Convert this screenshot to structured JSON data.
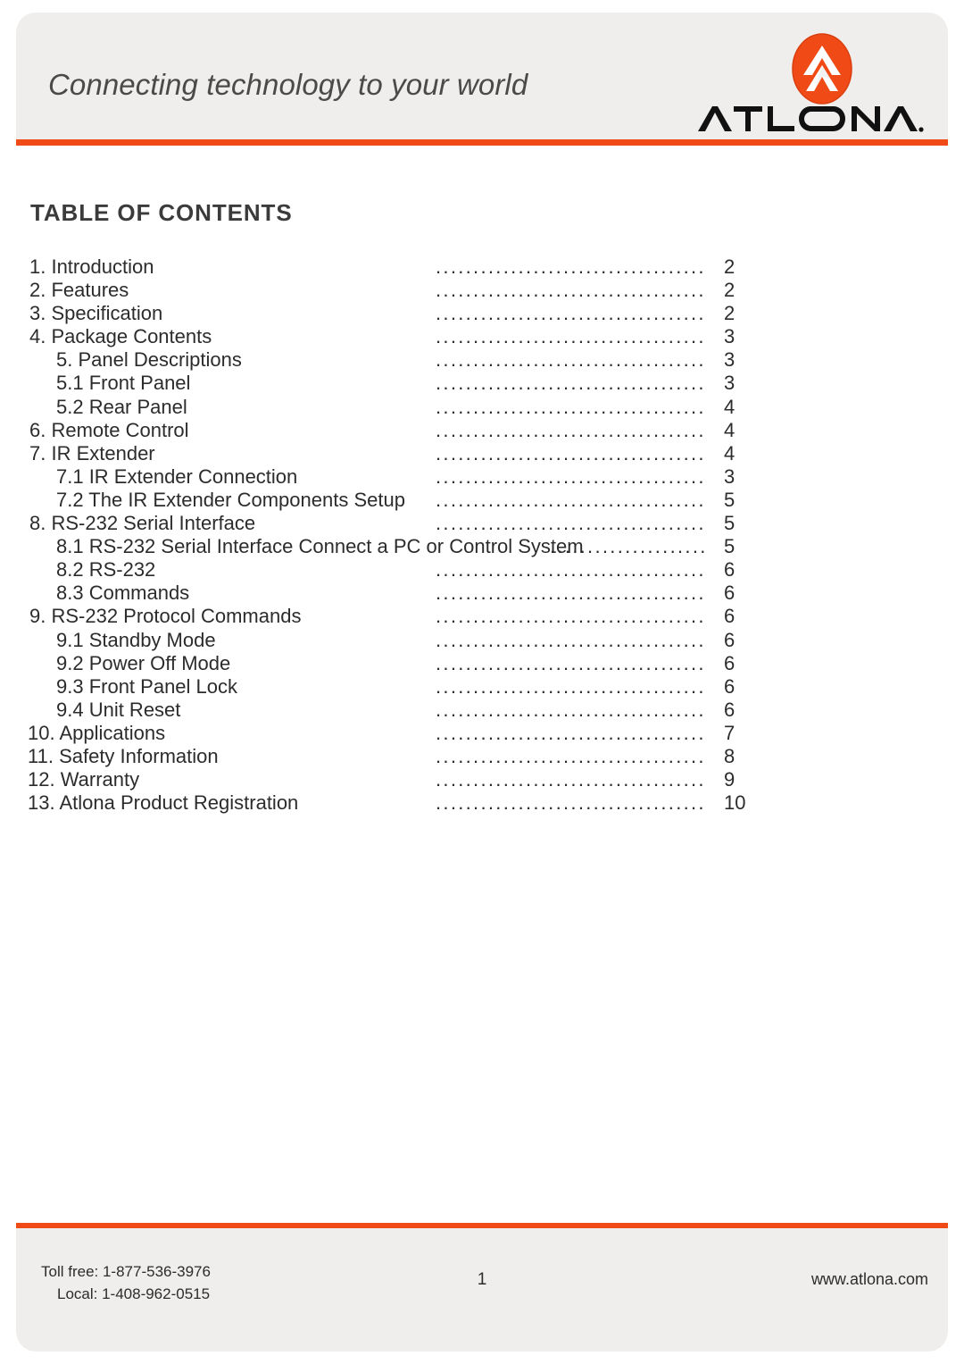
{
  "header": {
    "tagline": "Connecting technology to your world",
    "logo_mark": "atlona-logo-mark",
    "wordmark": "ATLONA."
  },
  "colors": {
    "accent_orange": "#F04A16",
    "band_gray": "#EFEEEC",
    "text": "#2C2C2C",
    "heading": "#3B3B3B"
  },
  "main": {
    "title": "TABLE OF CONTENTS",
    "dot_leader": "...............................................",
    "dot_leader_short": "........................",
    "entries": [
      {
        "label": "1. Introduction",
        "page": "2",
        "level": 0
      },
      {
        "label": "2. Features",
        "page": "2",
        "level": 0
      },
      {
        "label": "3. Specification",
        "page": "2",
        "level": 0
      },
      {
        "label": "4. Package Contents",
        "page": "3",
        "level": 0
      },
      {
        "label": "5. Panel Descriptions",
        "page": "3",
        "level": 1
      },
      {
        "label": "5.1 Front Panel",
        "page": "3",
        "level": 1
      },
      {
        "label": "5.2 Rear Panel",
        "page": "4",
        "level": 1
      },
      {
        "label": "6. Remote Control",
        "page": "4",
        "level": 0
      },
      {
        "label": "7. IR Extender",
        "page": "4",
        "level": 0
      },
      {
        "label": "7.1 IR Extender Connection",
        "page": "3",
        "level": 1
      },
      {
        "label": "7.2 The IR Extender Components Setup",
        "page": "5",
        "level": 1
      },
      {
        "label": "8. RS-232 Serial Interface",
        "page": "5",
        "level": 0
      },
      {
        "label": "8.1 RS-232 Serial Interface Connect a PC or Control System",
        "page": "5",
        "level": 1,
        "long": true
      },
      {
        "label": "8.2 RS-232",
        "page": "6",
        "level": 1
      },
      {
        "label": "8.3 Commands",
        "page": "6",
        "level": 1
      },
      {
        "label": "9. RS-232 Protocol Commands",
        "page": "6",
        "level": 0
      },
      {
        "label": "9.1 Standby Mode",
        "page": "6",
        "level": 1
      },
      {
        "label": "9.2 Power Off Mode",
        "page": "6",
        "level": 1
      },
      {
        "label": "9.3 Front Panel Lock",
        "page": "6",
        "level": 1
      },
      {
        "label": "9.4 Unit Reset",
        "page": "6",
        "level": 1
      },
      {
        "label": "10. Applications",
        "page": "7",
        "level": 0,
        "wide": true
      },
      {
        "label": "11. Safety Information",
        "page": "8",
        "level": 0,
        "wide": true
      },
      {
        "label": "12. Warranty",
        "page": "9",
        "level": 0,
        "wide": true
      },
      {
        "label": "13. Atlona Product Registration",
        "page": "10",
        "level": 0,
        "wide": true
      }
    ]
  },
  "footer": {
    "toll_free": "Toll free: 1-877-536-3976",
    "local": "Local: 1-408-962-0515",
    "page_number": "1",
    "website": "www.atlona.com"
  }
}
